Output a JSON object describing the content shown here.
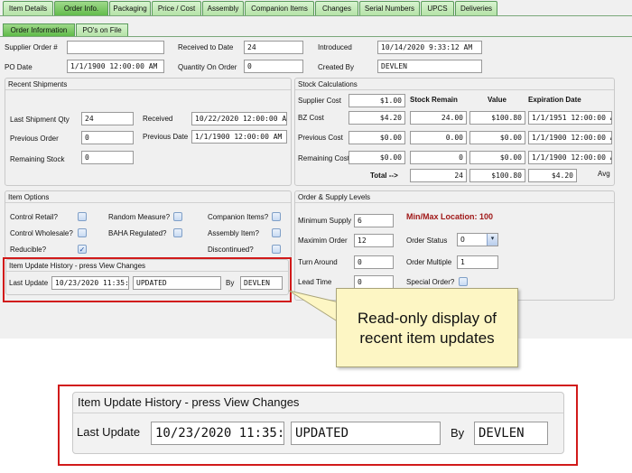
{
  "tabs": [
    "Item Details",
    "Order Info.",
    "Packaging",
    "Price / Cost",
    "Assembly",
    "Companion Items",
    "Changes",
    "Serial Numbers",
    "UPCS",
    "Deliveries"
  ],
  "active_tab": "Order Info.",
  "subtabs": [
    "Order Information",
    "PO's on File"
  ],
  "header": {
    "supplier_order_label": "Supplier Order #",
    "supplier_order_value": "",
    "po_date_label": "PO Date",
    "po_date_value": "1/1/1900 12:00:00 AM",
    "received_to_date_label": "Received to Date",
    "received_to_date_value": "24",
    "qty_on_order_label": "Quantity On Order",
    "qty_on_order_value": "0",
    "introduced_label": "Introduced",
    "introduced_value": "10/14/2020 9:33:12 AM",
    "created_by_label": "Created By",
    "created_by_value": "DEVLEN"
  },
  "recent_shipments": {
    "title": "Recent Shipments",
    "last_qty_label": "Last Shipment Qty",
    "last_qty_value": "24",
    "received_label": "Received",
    "received_value": "10/22/2020 12:00:00 AM",
    "prev_order_label": "Previous Order",
    "prev_order_value": "0",
    "prev_date_label": "Previous Date",
    "prev_date_value": "1/1/1900 12:00:00 AM",
    "remaining_label": "Remaining Stock",
    "remaining_value": "0"
  },
  "stock_calc": {
    "title": "Stock Calculations",
    "col_remain": "Stock Remain",
    "col_value": "Value",
    "col_exp": "Expiration Date",
    "rows": [
      {
        "label": "Supplier Cost",
        "cost": "$1.00",
        "remain": "",
        "value": "",
        "exp": ""
      },
      {
        "label": "BZ Cost",
        "cost": "$4.20",
        "remain": "24.00",
        "value": "$100.80",
        "exp": "1/1/1951 12:00:00 A"
      },
      {
        "label": "Previous Cost",
        "cost": "$0.00",
        "remain": "0.00",
        "value": "$0.00",
        "exp": "1/1/1900 12:00:00 A"
      },
      {
        "label": "Remaining Cost",
        "cost": "$0.00",
        "remain": "0",
        "value": "$0.00",
        "exp": "1/1/1900 12:00:00 A"
      }
    ],
    "total_label": "Total -->",
    "total_remain": "24",
    "total_value": "$100.80",
    "avg_value": "$4.20",
    "avg_label": "Avg"
  },
  "item_options": {
    "title": "Item Options",
    "control_retail": "Control Retail?",
    "random_measure": "Random Measure?",
    "companion_items": "Companion Items?",
    "control_wholesale": "Control Wholesale?",
    "baha_regulated": "BAHA Regulated?",
    "assembly_item": "Assembly Item?",
    "reducible": "Reducible?",
    "discontinued": "Discontinued?",
    "check_mark": "✓"
  },
  "history": {
    "title": "Item Update History - press View Changes",
    "last_update_label": "Last Update",
    "last_update_value": "10/23/2020 11:35:",
    "status_value": "UPDATED",
    "by_label": "By",
    "by_value": "DEVLEN"
  },
  "supply": {
    "title": "Order & Supply Levels",
    "min_label": "Minimum Supply",
    "min_value": "6",
    "max_label": "Maximim Order",
    "max_value": "12",
    "turn_label": "Turn Around",
    "turn_value": "0",
    "lead_label": "Lead Time",
    "lead_value": "0",
    "minmax_location": "Min/Max Location: 100",
    "status_label": "Order Status",
    "status_value": "O",
    "multiple_label": "Order Multiple",
    "multiple_value": "1",
    "special_label": "Special Order?"
  },
  "callout_line1": "Read-only display of",
  "callout_line2": "recent item updates",
  "colors": {
    "highlight": "#d11a1a",
    "tab_green": "#5fba48",
    "callout_bg": "#fdf6c4",
    "minmax_red": "#a01818"
  }
}
